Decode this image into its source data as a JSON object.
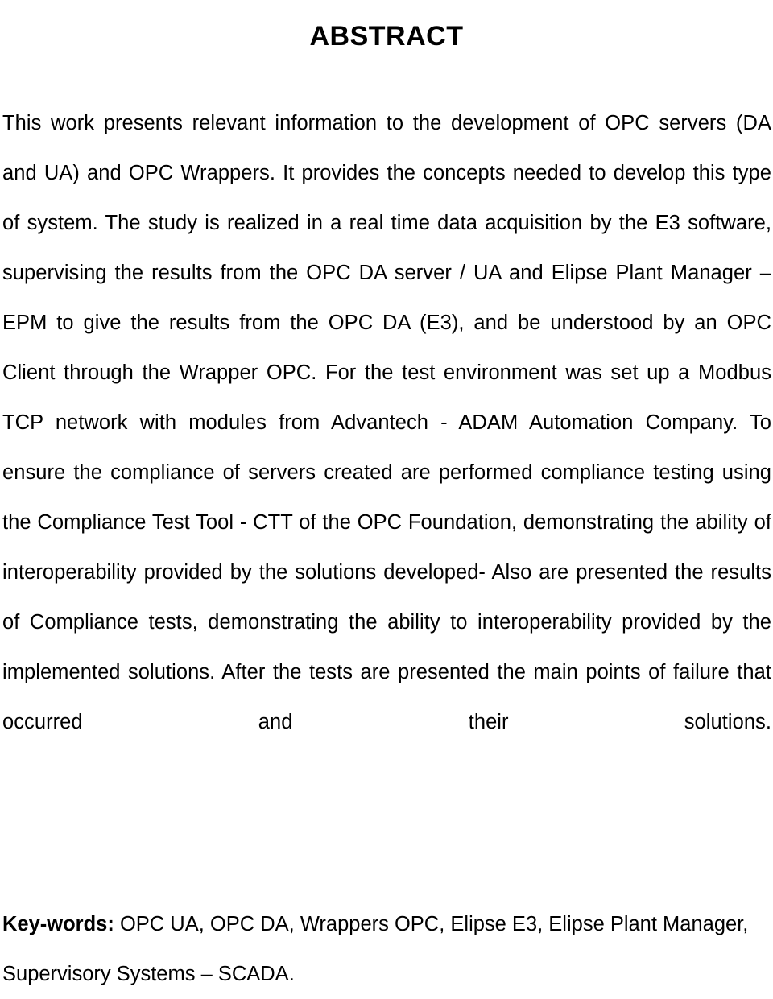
{
  "document": {
    "type": "academic-abstract-page",
    "language": "en",
    "background_color": "#ffffff",
    "text_color": "#000000"
  },
  "title": {
    "text": "ABSTRACT"
  },
  "abstract": {
    "text": "This work presents relevant information to the development of OPC servers (DA and UA) and OPC Wrappers. It provides the concepts needed to develop this type of system. The study is realized in a real time data acquisition by the E3 software, supervising the results from the OPC DA server / UA and Elipse Plant Manager – EPM to give the results from the OPC DA (E3), and be understood by an OPC Client through the Wrapper OPC. For the test environment was set up a Modbus TCP network with modules from Advantech - ADAM Automation Company. To ensure the compliance of servers created are performed compliance testing using the Compliance Test Tool - CTT of the OPC Foundation, demonstrating the ability of interoperability provided by the solutions developed- Also are presented the results of Compliance tests, demonstrating the ability to interoperability provided by the implemented solutions. After the tests are presented the main points of failure that occurred and their solutions.",
    "lines": [
      "This work presents relevant information to the development of OPC servers (DA",
      "and UA) and OPC Wrappers. It provides the concepts needed to develop this",
      "type of system. The study is realized in a real time data acquisition by the E3",
      "software, supervising the results from the OPC DA server / UA and Elipse Plant",
      "Manager – EPM to give the results from the OPC DA (E3), and be understood",
      "by an OPC Client through the Wrapper OPC. For the test environment was set",
      "up a Modbus TCP network with modules from Advantech - ADAM Automation",
      "Company. To ensure the compliance of servers created are performed",
      "compliance testing using the Compliance Test Tool - CTT of the OPC",
      "Foundation, demonstrating the ability of interoperability provided by the",
      "solutions developed- Also are presented the results of Compliance tests,",
      "demonstrating the ability to interoperability provided by the implemented",
      "solutions. After the tests are presented the main points of failure that occurred",
      "and their solutions."
    ]
  },
  "keywords": {
    "label": "Key-words:",
    "text": " OPC UA, OPC DA, Wrappers OPC, Elipse E3, Elipse Plant Manager, Supervisory Systems – SCADA.",
    "items": [
      "OPC UA",
      "OPC DA",
      "Wrappers OPC",
      "Elipse E3",
      "Elipse Plant Manager",
      "Supervisory Systems – SCADA"
    ]
  }
}
